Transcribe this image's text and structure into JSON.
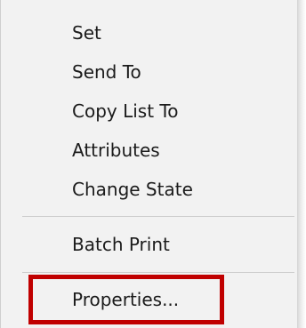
{
  "context_menu": {
    "items": [
      {
        "label": "Set"
      },
      {
        "label": "Send To"
      },
      {
        "label": "Copy List To"
      },
      {
        "label": "Attributes"
      },
      {
        "label": "Change State"
      },
      {
        "label": "Batch Print"
      },
      {
        "label": "Properties..."
      }
    ]
  },
  "colors": {
    "menu_background": "#f2f2f2",
    "separator": "#cdcdcd",
    "highlight_box": "#c00000",
    "text": "#1b1b1b"
  }
}
